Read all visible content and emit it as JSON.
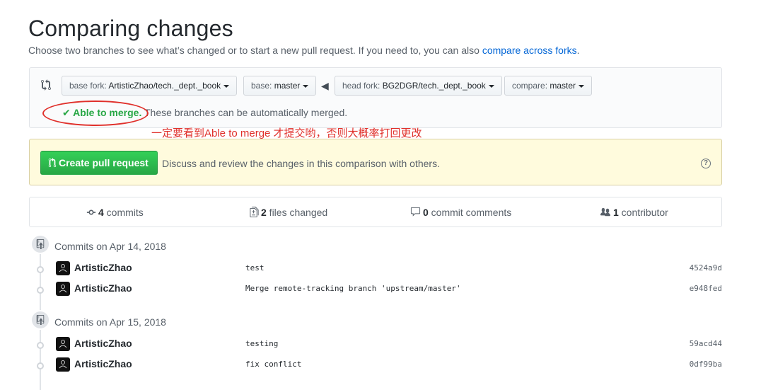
{
  "page": {
    "title": "Comparing changes",
    "subtitle": "Choose two branches to see what’s changed or to start a new pull request. If you need to, you can also",
    "subtitle_link": "compare across forks",
    "subtitle_end": "."
  },
  "range": {
    "base_fork_prefix": "base fork: ",
    "base_fork_value": "ArtisticZhao/tech._dept._book",
    "base_prefix": "base: ",
    "base_value": "master",
    "head_fork_prefix": "head fork: ",
    "head_fork_value": "BG2DGR/tech._dept._book",
    "compare_prefix": "compare: ",
    "compare_value": "master",
    "merge_ok": "✔ Able to merge.",
    "merge_text": " These branches can be automatically merged."
  },
  "annotation": {
    "text": "一定要看到Able to merge 才提交哟，否则大概率打回更改",
    "color": "#e0302b"
  },
  "pr": {
    "button_label": "Create pull request",
    "description": "Discuss and review the changes in this comparison with others.",
    "help": "?"
  },
  "stats": {
    "commits_count": "4",
    "commits_label": " commits",
    "files_count": "2",
    "files_label": " files changed",
    "comments_count": "0",
    "comments_label": " commit comments",
    "contributors_count": "1",
    "contributors_label": " contributor"
  },
  "commit_groups": [
    {
      "title": "Commits on Apr 14, 2018",
      "commits": [
        {
          "author": "ArtisticZhao",
          "message": "test",
          "sha": "4524a9d"
        },
        {
          "author": "ArtisticZhao",
          "message": "Merge remote-tracking branch 'upstream/master'",
          "sha": "e948fed"
        }
      ]
    },
    {
      "title": "Commits on Apr 15, 2018",
      "commits": [
        {
          "author": "ArtisticZhao",
          "message": "testing",
          "sha": "59acd44"
        },
        {
          "author": "ArtisticZhao",
          "message": "fix conflict",
          "sha": "0df99ba"
        }
      ]
    }
  ],
  "colors": {
    "green": "#28a745",
    "link": "#0366d6",
    "annotation_red": "#e0302b"
  }
}
